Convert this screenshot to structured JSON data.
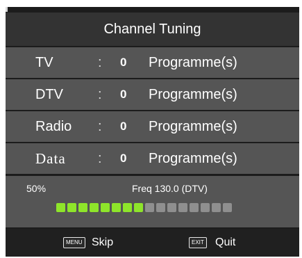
{
  "dialog": {
    "title": "Channel Tuning"
  },
  "rows": [
    {
      "label": "TV",
      "colon": ":",
      "count": "0",
      "unit": "Programme(s)"
    },
    {
      "label": "DTV",
      "colon": ":",
      "count": "0",
      "unit": "Programme(s)"
    },
    {
      "label": "Radio",
      "colon": ":",
      "count": "0",
      "unit": "Programme(s)"
    },
    {
      "label": "Data",
      "colon": ":",
      "count": "0",
      "unit": "Programme(s)"
    }
  ],
  "status": {
    "percent": "50%",
    "frequency": "Freq 130.0  (DTV)",
    "progress_fraction": 0.5,
    "progress_segments_total": 16
  },
  "footer": {
    "menu_key": "MENU",
    "skip_label": "Skip",
    "exit_key": "EXIT",
    "quit_label": "Quit"
  },
  "colors": {
    "progress_on": "#8ee52a",
    "progress_off": "#8f8f8f",
    "panel": "#555555",
    "header": "#333333"
  }
}
